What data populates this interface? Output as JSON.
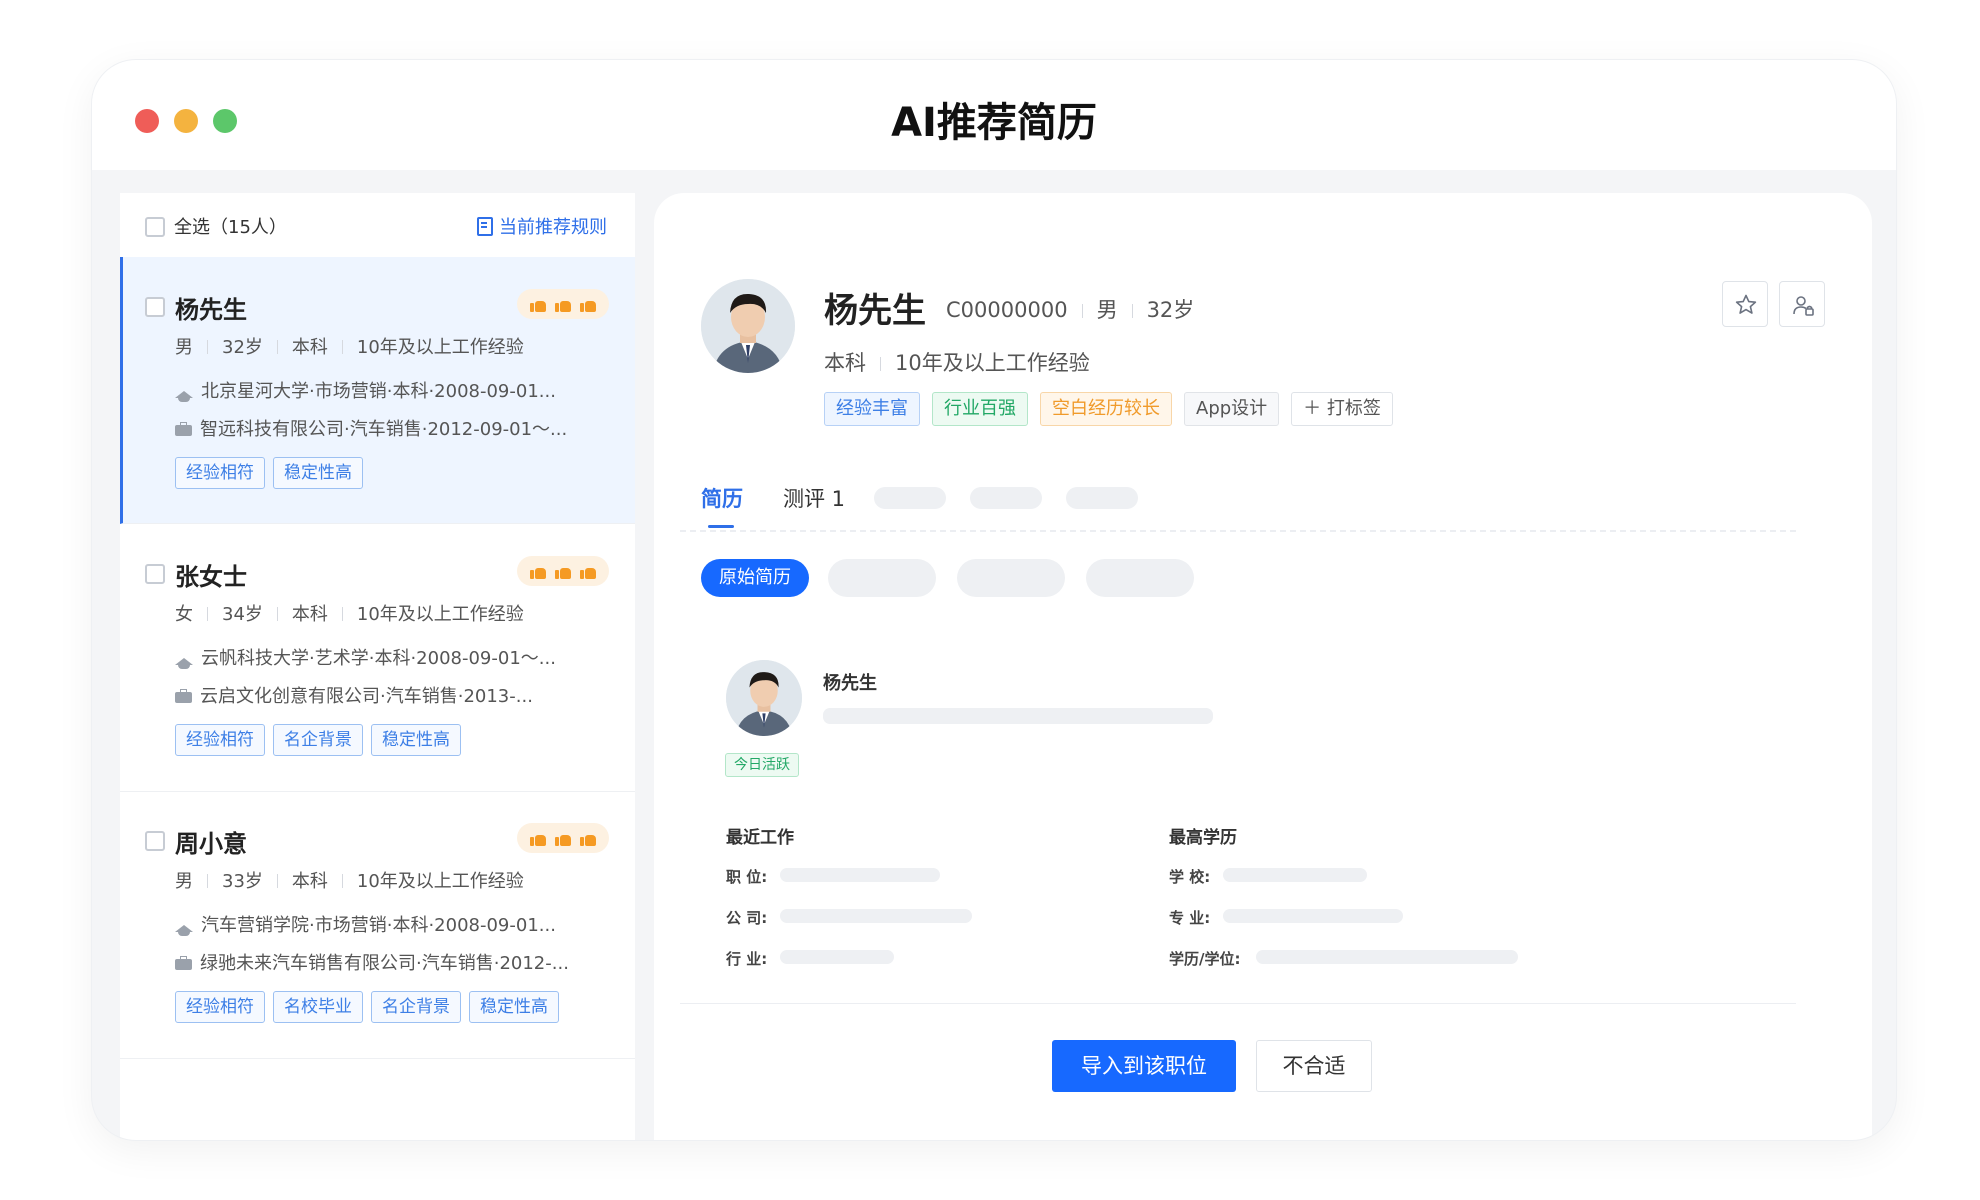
{
  "window": {
    "title": "AI推荐简历"
  },
  "list": {
    "select_all": "全选（15人）",
    "rule_link": "当前推荐规则",
    "candidates": [
      {
        "name": "杨先生",
        "gender": "男",
        "age": "32岁",
        "degree": "本科",
        "experience": "10年及以上工作经验",
        "education": "北京星河大学·市场营销·本科·2008-09-01...",
        "work": "智远科技有限公司·汽车销售·2012-09-01～...",
        "tags": [
          "经验相符",
          "稳定性高"
        ],
        "rating": 3
      },
      {
        "name": "张女士",
        "gender": "女",
        "age": "34岁",
        "degree": "本科",
        "experience": "10年及以上工作经验",
        "education": "云帆科技大学·艺术学·本科·2008-09-01～...",
        "work": "云启文化创意有限公司·汽车销售·2013-...",
        "tags": [
          "经验相符",
          "名企背景",
          "稳定性高"
        ],
        "rating": 3
      },
      {
        "name": "周小意",
        "gender": "男",
        "age": "33岁",
        "degree": "本科",
        "experience": "10年及以上工作经验",
        "education": "汽车营销学院·市场营销·本科·2008-09-01...",
        "work": "绿驰未来汽车销售有限公司·汽车销售·2012-...",
        "tags": [
          "经验相符",
          "名校毕业",
          "名企背景",
          "稳定性高"
        ],
        "rating": 3
      }
    ]
  },
  "detail": {
    "name": "杨先生",
    "id": "C00000000",
    "gender": "男",
    "age": "32岁",
    "degree": "本科",
    "experience": "10年及以上工作经验",
    "tags": [
      "经验丰富",
      "行业百强",
      "空白经历较长",
      "App设计"
    ],
    "add_tag": "＋ 打标签",
    "tabs": {
      "resume": "简历",
      "evaluation": "测评 1"
    },
    "subtab_active": "原始简历",
    "card": {
      "name": "杨先生",
      "active_badge": "今日活跃",
      "recent_work": "最近工作",
      "highest_edu": "最高学历",
      "position_label": "职 位:",
      "company_label": "公 司:",
      "industry_label": "行 业:",
      "school_label": "学 校:",
      "major_label": "专 业:",
      "degree_label": "学历/学位:"
    },
    "actions": {
      "import": "导入到该职位",
      "reject": "不合适"
    }
  },
  "colors": {
    "accent": "#1769ff",
    "rating": "#f59a23"
  },
  "icons": {
    "star": "star-icon",
    "share": "user-share-icon",
    "rule": "document-icon"
  }
}
